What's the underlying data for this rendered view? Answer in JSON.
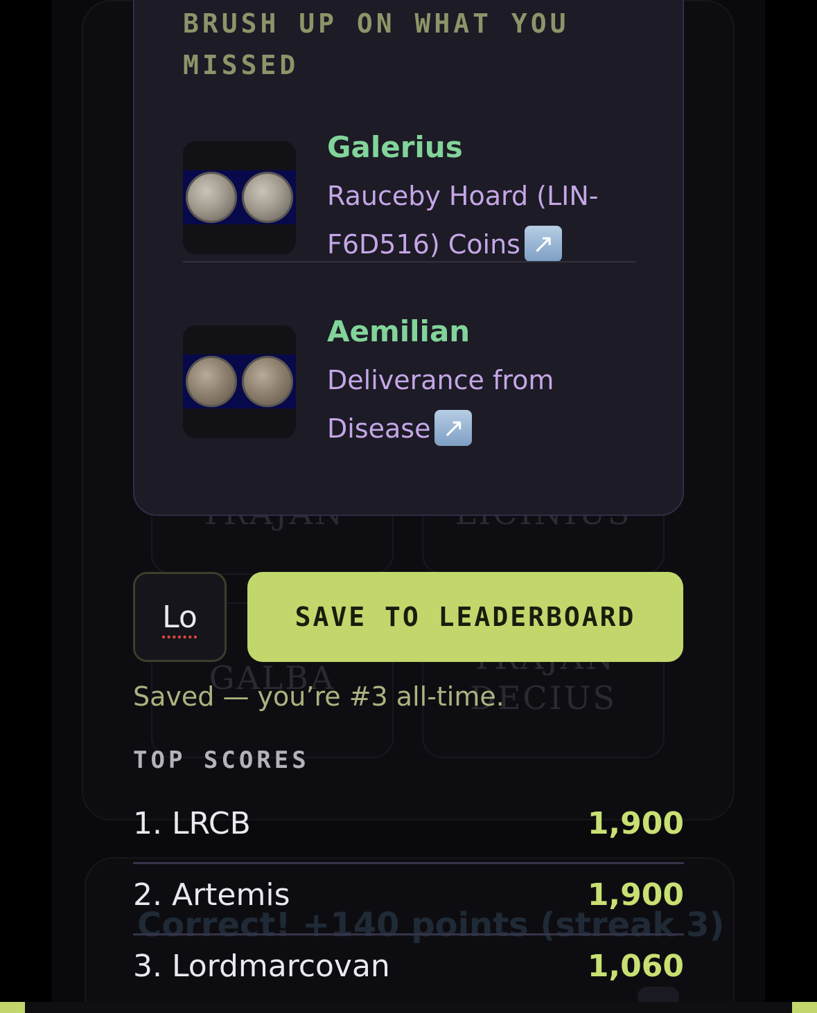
{
  "background": {
    "tiles": [
      "TRAJAN",
      "LICINIUS",
      "GALBA",
      "TRAJAN",
      "DECIUS"
    ],
    "feedback": "Correct! +140 points (streak 3)"
  },
  "results": {
    "heading": "BRUSH UP ON WHAT YOU MISSED",
    "missed": [
      {
        "name": "Galerius",
        "title": "Rauceby Hoard (LIN-F6D516) Coins",
        "link_icon": "external-link-icon"
      },
      {
        "name": "Aemilian",
        "title": "Deliverance from Disease",
        "link_icon": "external-link-icon"
      }
    ]
  },
  "save": {
    "initials_value": "Lo",
    "button_label": "SAVE TO LEADERBOARD",
    "status": "Saved — you’re #3 all-time."
  },
  "leaderboard": {
    "heading": "TOP SCORES",
    "entries": [
      {
        "label": "1. LRCB",
        "score": "1,900"
      },
      {
        "label": "2. Artemis",
        "score": "1,900"
      },
      {
        "label": "3. Lordmarcovan",
        "score": "1,060"
      }
    ]
  },
  "colors": {
    "accent": "#c1d76c",
    "score": "#c8e073",
    "coin_name": "#82d49a",
    "coin_title": "#c5a6e6",
    "heading": "#8e9469"
  }
}
